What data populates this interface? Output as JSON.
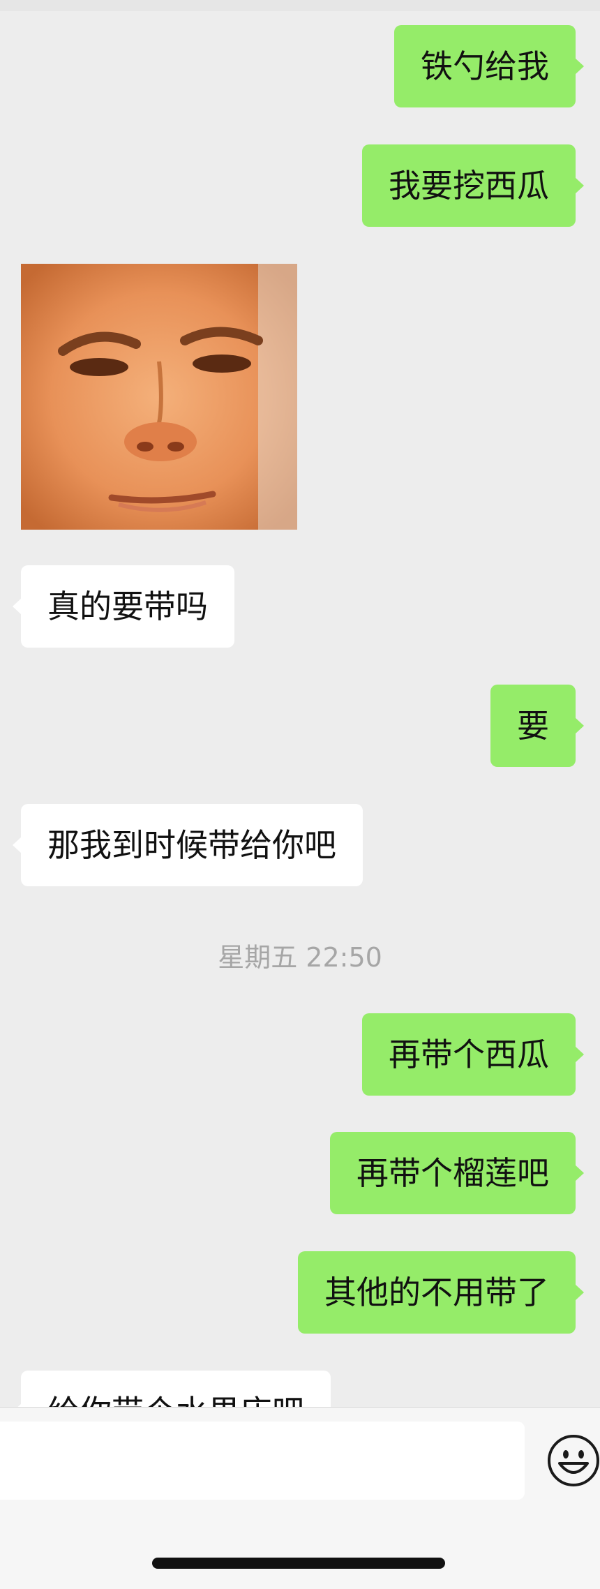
{
  "chat": {
    "messages": [
      {
        "dir": "out",
        "text": "铁勺给我"
      },
      {
        "dir": "out",
        "text": "我要挖西瓜"
      },
      {
        "dir": "in",
        "text": "真的要带吗"
      },
      {
        "dir": "out",
        "text": "要"
      },
      {
        "dir": "in",
        "text": "那我到时候带给你吧"
      },
      {
        "dir": "out",
        "text": "再带个西瓜"
      },
      {
        "dir": "out",
        "text": "再带个榴莲吧"
      },
      {
        "dir": "out",
        "text": "其他的不用带了"
      },
      {
        "dir": "in",
        "text": "给你带个水果店吧"
      }
    ],
    "timestamp": "星期五 22:50",
    "sticker_icon": "face-photo-sticker"
  },
  "input_bar": {
    "value": "",
    "emoji_icon": "smiley-emoji-icon"
  },
  "colors": {
    "outgoing_bubble": "#95ec69",
    "incoming_bubble": "#ffffff",
    "background": "#ededed",
    "timestamp_text": "#a6a6a6"
  }
}
